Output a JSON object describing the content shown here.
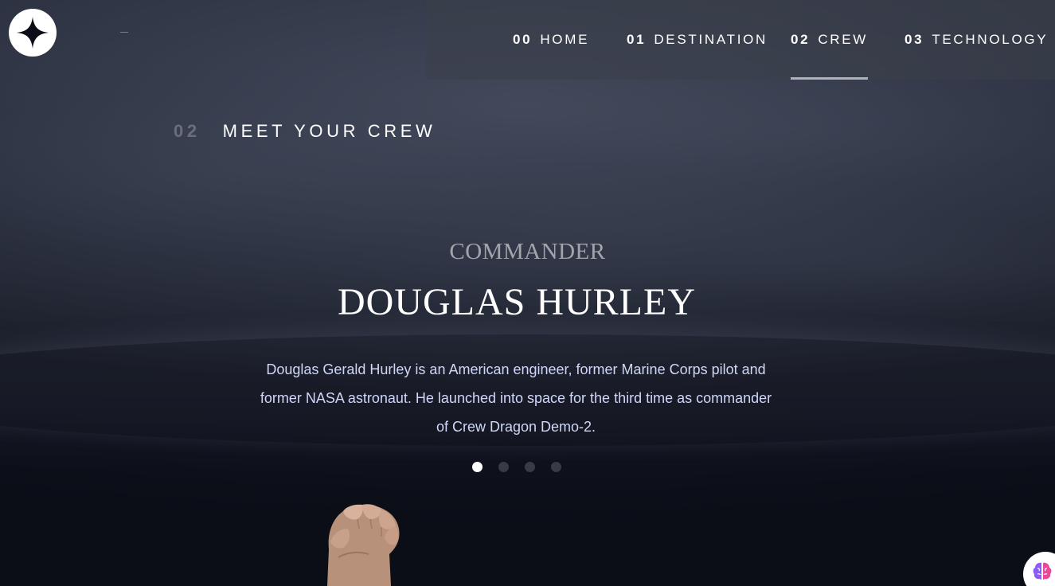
{
  "header": {
    "logo_icon": "star-logo-icon",
    "nav": [
      {
        "num": "00",
        "label": "HOME",
        "active": false
      },
      {
        "num": "01",
        "label": "DESTINATION",
        "active": false
      },
      {
        "num": "02",
        "label": "CREW",
        "active": true
      },
      {
        "num": "03",
        "label": "TECHNOLOGY",
        "active": false
      }
    ]
  },
  "page": {
    "heading_num": "02",
    "heading_text": "MEET YOUR CREW"
  },
  "crew": {
    "role": "COMMANDER",
    "name": "DOUGLAS HURLEY",
    "bio": "Douglas Gerald Hurley is an American engineer, former Marine Corps pilot and former NASA astronaut. He launched into space for the third time as commander of Crew Dragon Demo-2.",
    "dots_count": 4,
    "active_dot": 0,
    "image_icon": "raised-fist-image"
  },
  "widget": {
    "icon": "brain-icon"
  },
  "colors": {
    "background": "#0b0d17",
    "bio_text": "#d0d6f9",
    "accent": "#ffffff"
  }
}
